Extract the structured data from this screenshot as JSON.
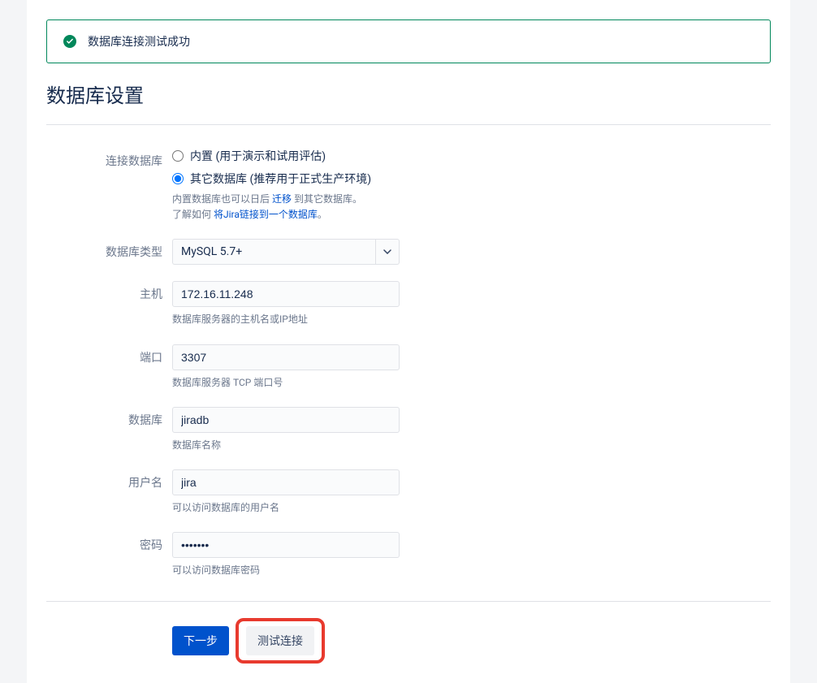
{
  "alert": {
    "message": "数据库连接测试成功"
  },
  "page": {
    "title": "数据库设置"
  },
  "form": {
    "connection": {
      "label": "连接数据库",
      "options": {
        "builtin": "内置 (用于演示和试用评估)",
        "external": "其它数据库 (推荐用于正式生产环境)"
      },
      "selected": "external",
      "help": {
        "line1_prefix": "内置数据库也可以日后 ",
        "line1_link": "迁移",
        "line1_suffix": " 到其它数据库。",
        "line2_prefix": "了解如何 ",
        "line2_link": "将Jira链接到一个数据库",
        "line2_suffix": "。"
      }
    },
    "dbtype": {
      "label": "数据库类型",
      "value": "MySQL 5.7+"
    },
    "host": {
      "label": "主机",
      "value": "172.16.11.248",
      "help": "数据库服务器的主机名或IP地址"
    },
    "port": {
      "label": "端口",
      "value": "3307",
      "help": "数据库服务器 TCP 端口号"
    },
    "database": {
      "label": "数据库",
      "value": "jiradb",
      "help": "数据库名称"
    },
    "username": {
      "label": "用户名",
      "value": "jira",
      "help": "可以访问数据库的用户名"
    },
    "password": {
      "label": "密码",
      "value": "•••••••",
      "help": "可以访问数据库密码"
    }
  },
  "buttons": {
    "next": "下一步",
    "test": "测试连接"
  }
}
